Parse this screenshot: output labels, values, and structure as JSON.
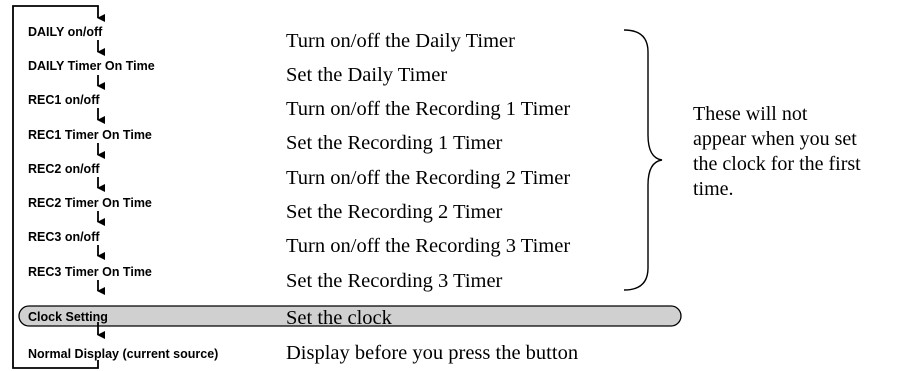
{
  "steps": [
    {
      "label": "DAILY on/off",
      "description": "Turn on/off the Daily Timer"
    },
    {
      "label": "DAILY Timer On Time",
      "description": "Set the Daily Timer"
    },
    {
      "label": "REC1 on/off",
      "description": "Turn on/off the Recording 1 Timer"
    },
    {
      "label": "REC1 Timer On Time",
      "description": "Set the Recording 1 Timer"
    },
    {
      "label": "REC2 on/off",
      "description": "Turn on/off the Recording 2 Timer"
    },
    {
      "label": "REC2 Timer On Time",
      "description": "Set the Recording 2 Timer"
    },
    {
      "label": "REC3 on/off",
      "description": "Turn on/off the Recording 3 Timer"
    },
    {
      "label": "REC3 Timer On Time",
      "description": "Set the Recording 3 Timer"
    },
    {
      "label": "Clock Setting",
      "description": "Set the clock",
      "highlighted": true
    },
    {
      "label": "Normal Display (current source)",
      "description": "Display before you press the button"
    }
  ],
  "note": {
    "lines": [
      "These will not",
      "appear when you set",
      "the clock for the first",
      "time."
    ]
  },
  "colors": {
    "highlight_fill": "#d0d0d0",
    "line": "#000000"
  }
}
